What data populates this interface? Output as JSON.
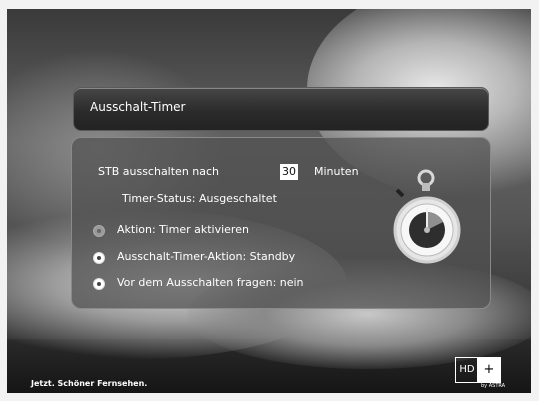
{
  "window": {
    "title": "Ausschalt-Timer"
  },
  "settings": {
    "stb_label": "STB ausschalten nach",
    "stb_value": "30",
    "stb_unit": "Minuten",
    "timer_status": "Timer-Status: Ausgeschaltet"
  },
  "options": [
    {
      "label": "Aktion: Timer aktivieren"
    },
    {
      "label": "Ausschalt-Timer-Aktion: Standby"
    },
    {
      "label": "Vor dem Ausschalten fragen: nein"
    }
  ],
  "footer": {
    "slogan": "Jetzt. Schöner Fernsehen.",
    "logo_hd": "HD",
    "logo_plus": "+",
    "logo_by": "by ASTRA"
  },
  "icons": {
    "stopwatch": "stopwatch-icon",
    "radio": "radio-icon"
  }
}
